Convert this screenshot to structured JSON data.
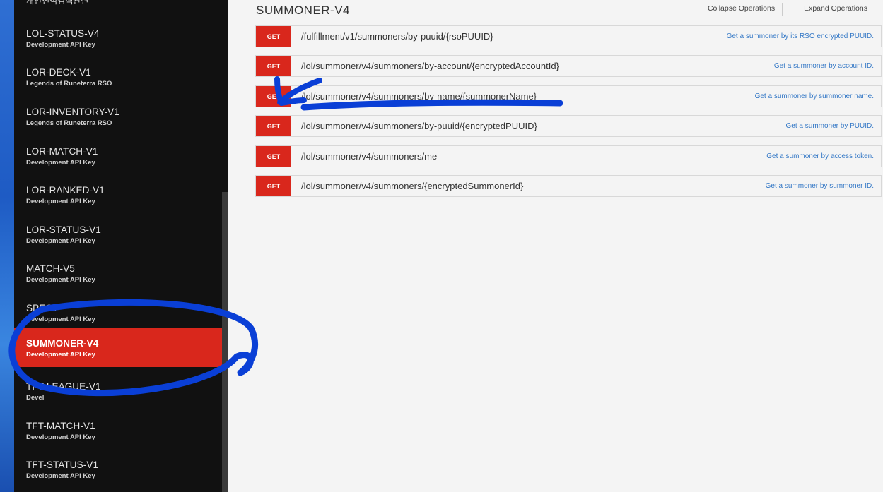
{
  "sidebar": {
    "top_partial": "개인전적검색관련",
    "items": [
      {
        "name": "LOL-STATUS-V4",
        "sub": "Development API Key"
      },
      {
        "name": "LOR-DECK-V1",
        "sub": "Legends of Runeterra RSO"
      },
      {
        "name": "LOR-INVENTORY-V1",
        "sub": "Legends of Runeterra RSO"
      },
      {
        "name": "LOR-MATCH-V1",
        "sub": "Development API Key"
      },
      {
        "name": "LOR-RANKED-V1",
        "sub": "Development API Key"
      },
      {
        "name": "LOR-STATUS-V1",
        "sub": "Development API Key"
      },
      {
        "name": "MATCH-V5",
        "sub": "Development API Key"
      },
      {
        "name": "SPECT",
        "sub": "Development API Key"
      },
      {
        "name": "SUMMONER-V4",
        "sub": "Development API Key"
      },
      {
        "name": "TFT-LEAGUE-V1",
        "sub": "Devel"
      },
      {
        "name": "TFT-MATCH-V1",
        "sub": "Development API Key"
      },
      {
        "name": "TFT-STATUS-V1",
        "sub": "Development API Key"
      }
    ]
  },
  "main": {
    "title": "SUMMONER-V4",
    "collapse_label": "Collapse Operations",
    "expand_label": "Expand Operations",
    "operations": [
      {
        "method": "GET",
        "path": "/fulfillment/v1/summoners/by-puuid/{rsoPUUID}",
        "desc": "Get a summoner by its RSO encrypted PUUID."
      },
      {
        "method": "GET",
        "path": "/lol/summoner/v4/summoners/by-account/{encryptedAccountId}",
        "desc": "Get a summoner by account ID."
      },
      {
        "method": "GET",
        "path": "/lol/summoner/v4/summoners/by-name/{summonerName}",
        "desc": "Get a summoner by summoner name."
      },
      {
        "method": "GET",
        "path": "/lol/summoner/v4/summoners/by-puuid/{encryptedPUUID}",
        "desc": "Get a summoner by PUUID."
      },
      {
        "method": "GET",
        "path": "/lol/summoner/v4/summoners/me",
        "desc": "Get a summoner by access token."
      },
      {
        "method": "GET",
        "path": "/lol/summoner/v4/summoners/{encryptedSummonerId}",
        "desc": "Get a summoner by summoner ID."
      }
    ]
  },
  "colors": {
    "accent": "#d9271c",
    "annotation": "#0a3fd6",
    "link": "#3478c6"
  }
}
